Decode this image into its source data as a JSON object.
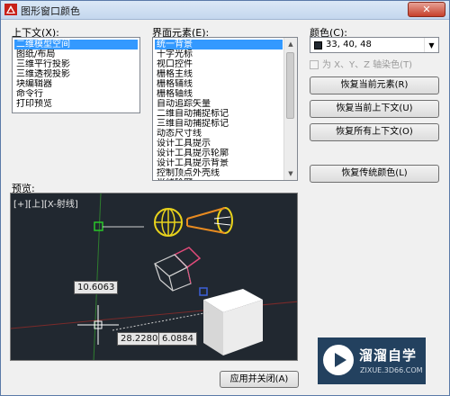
{
  "window": {
    "title": "图形窗口颜色",
    "close": "✕"
  },
  "context": {
    "label": "上下文(X):",
    "items": [
      "二维模型空间",
      "图纸/布局",
      "三维平行投影",
      "三维透视投影",
      "块编辑器",
      "命令行",
      "打印预览"
    ],
    "selected_index": 0
  },
  "interface": {
    "label": "界面元素(E):",
    "items": [
      "统一背景",
      "十字光标",
      "视口控件",
      "栅格主线",
      "栅格辅线",
      "栅格轴线",
      "自动追踪矢量",
      "二维自动捕捉标记",
      "三维自动捕捉标记",
      "动态尺寸线",
      "设计工具提示",
      "设计工具提示轮廓",
      "设计工具提示背景",
      "控制顶点外壳线",
      "光线轮廓"
    ],
    "selected_index": 0
  },
  "color": {
    "label": "颜色(C):",
    "value": "33, 40, 48",
    "swatch": "#212830",
    "checkbox_label": "为 X、Y、Z 轴染色(T)"
  },
  "buttons": {
    "restore_element": "恢复当前元素(R)",
    "restore_context": "恢复当前上下文(U)",
    "restore_all": "恢复所有上下文(O)",
    "restore_classic": "恢复传统颜色(L)",
    "apply_close": "应用并关闭(A)"
  },
  "preview": {
    "label": "预览:",
    "viewport_label": "[+][上][X-射线]",
    "dims": [
      "10.6063",
      "28.2280",
      "6.0884"
    ],
    "background": "#212830"
  },
  "watermark": {
    "title": "溜溜自学",
    "subtitle": "ZIXUE.3D66.COM"
  }
}
